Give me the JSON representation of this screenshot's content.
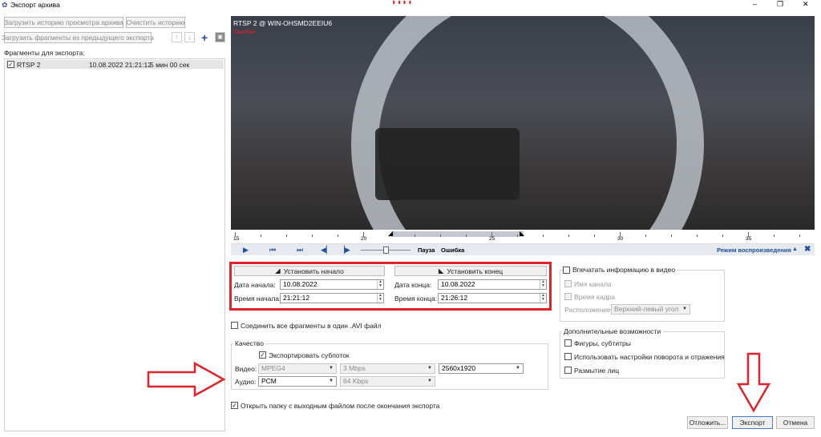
{
  "window": {
    "title": "Экспорт архива",
    "controls": {
      "minimize": "–",
      "restore": "❐",
      "close": "✕"
    }
  },
  "left": {
    "load_history_btn": "Загрузить историю просмотра архива",
    "clear_history_btn": "Очистить историю",
    "load_fragments_btn": "Загрузить фрагменты из предыдущего экспорта",
    "fragments_label": "Фрагменты для экспорта:",
    "fragments": [
      {
        "checked": true,
        "name": "RTSP 2",
        "datetime": "10.08.2022 21:21:12",
        "duration": "5 мин 00 сек"
      }
    ]
  },
  "video": {
    "camera_title": "RTSP 2 @ WIN-OHSMD2EEIU6",
    "overlay_status": "Ошибка",
    "timeline_labels": [
      "15",
      "20",
      "25",
      "30",
      "35"
    ],
    "status_pause": "Пауза",
    "status_error": "Ошибка",
    "playback_mode": "Режим воспроизведения"
  },
  "range": {
    "set_start_btn": "Установить начало",
    "set_end_btn": "Установить конец",
    "start_date_label": "Дата начала:",
    "start_date": "10.08.2022",
    "start_time_label": "Время начала:",
    "start_time": "21:21:12",
    "end_date_label": "Дата конца:",
    "end_date": "10.08.2022",
    "end_time_label": "Время конца:",
    "end_time": "21:26:12"
  },
  "info": {
    "print_info_label": "Впечатать информацию в видео",
    "channel_name_label": "Имя канала",
    "frame_time_label": "Время кадра",
    "position_label": "Расположение:",
    "position_value": "Верхний-левый угол"
  },
  "extra": {
    "title": "Дополнительные возможности",
    "figures_label": "Фигуры, субтитры",
    "rotation_label": "Использовать настройки поворота и отражения",
    "face_blur_label": "Размытие лиц"
  },
  "merge_label": "Соединить все фрагменты в один .AVI файл",
  "quality": {
    "title": "Качество",
    "export_subtitles_label": "Экспортировать субпоток",
    "video_label": "Видео:",
    "video_codec": "MPEG4",
    "video_bitrate": "3 Mbps",
    "video_resolution": "2560x1920",
    "audio_label": "Аудио:",
    "audio_codec": "PCM",
    "audio_bitrate": "64 Kbps"
  },
  "open_folder_label": "Открыть папку с выходным файлом после окончания экспорта",
  "footer": {
    "postpone_btn": "Отложить...",
    "export_btn": "Экспорт",
    "cancel_btn": "Отмена"
  },
  "colors": {
    "highlight": "#e0232b",
    "accent": "#1f4f9a"
  }
}
